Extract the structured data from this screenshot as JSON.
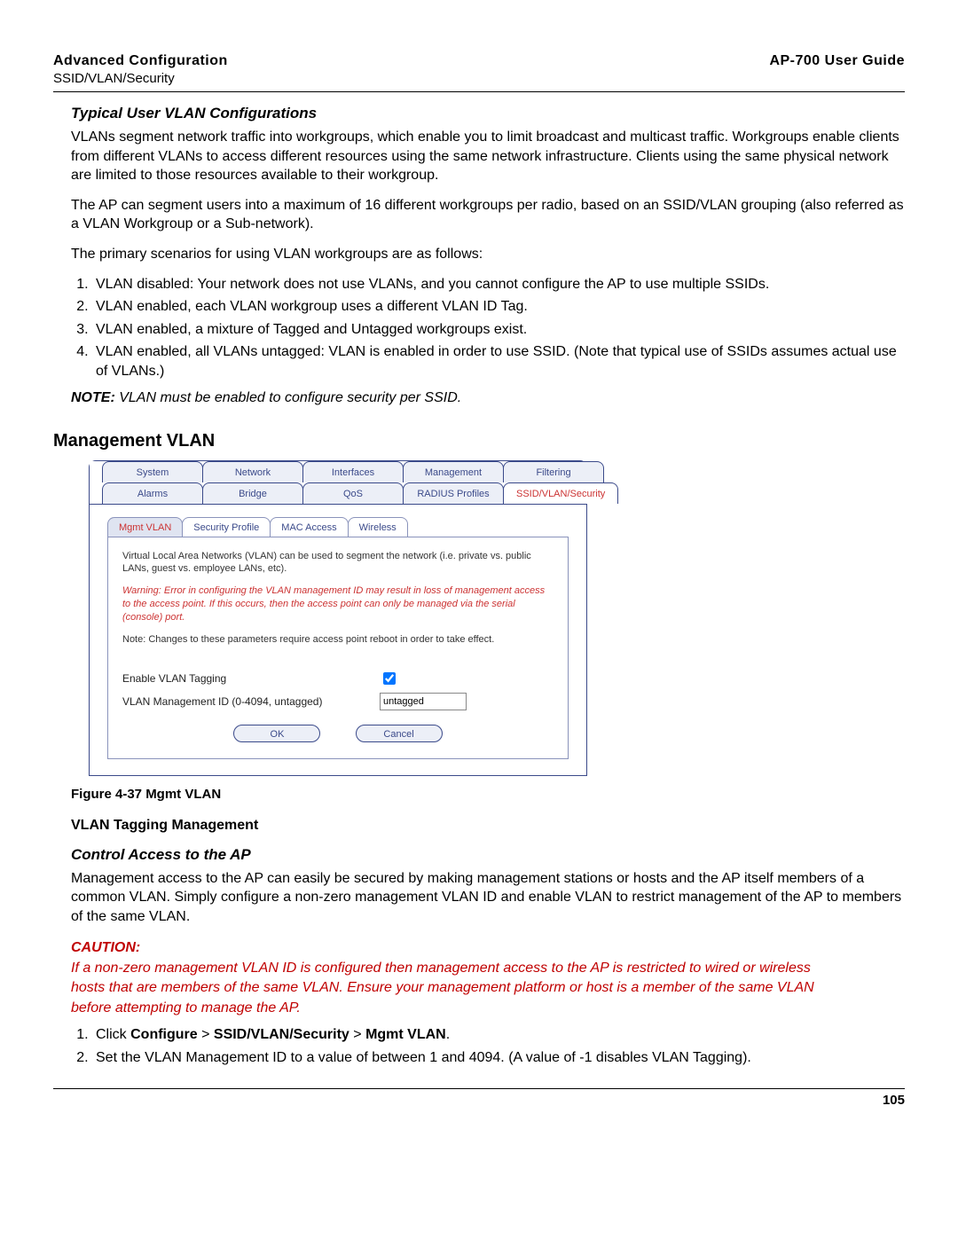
{
  "header": {
    "section": "Advanced Configuration",
    "subsection": "SSID/VLAN/Security",
    "guide": "AP-700 User Guide"
  },
  "typical": {
    "heading": "Typical User VLAN Configurations",
    "p1": "VLANs segment network traffic into workgroups, which enable you to limit broadcast and multicast traffic. Workgroups enable clients from different VLANs to access different resources using the same network infrastructure. Clients using the same physical network are limited to those resources available to their workgroup.",
    "p2": "The AP can segment users into a maximum of 16 different workgroups per radio, based on an SSID/VLAN grouping (also referred as a VLAN Workgroup or a Sub-network).",
    "p3": "The primary scenarios for using VLAN workgroups are as follows:",
    "items": [
      "VLAN disabled: Your network does not use VLANs, and you cannot configure the AP to use multiple SSIDs.",
      "VLAN enabled, each VLAN workgroup uses a different VLAN ID Tag.",
      "VLAN enabled, a mixture of Tagged and Untagged workgroups exist.",
      "VLAN enabled, all VLANs untagged: VLAN is enabled in order to use SSID. (Note that typical use of SSIDs assumes actual use of VLANs.)"
    ],
    "note_label": "NOTE:",
    "note_text": "VLAN must be enabled to configure security per SSID."
  },
  "mgmt_heading": "Management VLAN",
  "shot": {
    "tabs_row1": [
      "System",
      "Network",
      "Interfaces",
      "Management",
      "Filtering"
    ],
    "tabs_row2": [
      "Alarms",
      "Bridge",
      "QoS",
      "RADIUS Profiles",
      "SSID/VLAN/Security"
    ],
    "tabs_row2_selected": 4,
    "subtabs": [
      "Mgmt VLAN",
      "Security Profile",
      "MAC Access",
      "Wireless"
    ],
    "subtab_selected": 0,
    "intro": "Virtual Local Area Networks (VLAN) can be used to segment the network (i.e. private vs. public LANs, guest vs. employee LANs, etc).",
    "warn": "Warning: Error in configuring the VLAN management ID may result in loss of management access to the access point. If this occurs, then the access point can only be managed via the serial (console) port.",
    "note": "Note: Changes to these parameters require access point reboot in order to take effect.",
    "field_enable": "Enable VLAN Tagging",
    "field_id": "VLAN Management ID (0-4094, untagged)",
    "id_value": "untagged",
    "btn_ok": "OK",
    "btn_cancel": "Cancel"
  },
  "fig_caption": "Figure 4-37 Mgmt VLAN",
  "tagging_heading": "VLAN Tagging Management",
  "control_heading": "Control Access to the AP",
  "control_p": "Management access to the AP can easily be secured by making management stations or hosts and the AP itself members of a common VLAN. Simply configure a non-zero management VLAN ID and enable VLAN to restrict management of the AP to members of the same VLAN.",
  "caution": {
    "label": "CAUTION:",
    "text": "If a non-zero management VLAN ID is configured then management access to the AP is restricted to wired or wireless hosts that are members of the same VLAN. Ensure your management platform or host is a member of the same VLAN before attempting to manage the AP."
  },
  "steps": {
    "s1_pre": "Click ",
    "s1_b1": "Configure",
    "s1_gt1": " > ",
    "s1_b2": "SSID/VLAN/Security",
    "s1_gt2": " > ",
    "s1_b3": "Mgmt VLAN",
    "s1_post": ".",
    "s2": "Set the VLAN Management ID to a value of between 1 and 4094. (A value of -1 disables VLAN Tagging)."
  },
  "page_number": "105"
}
